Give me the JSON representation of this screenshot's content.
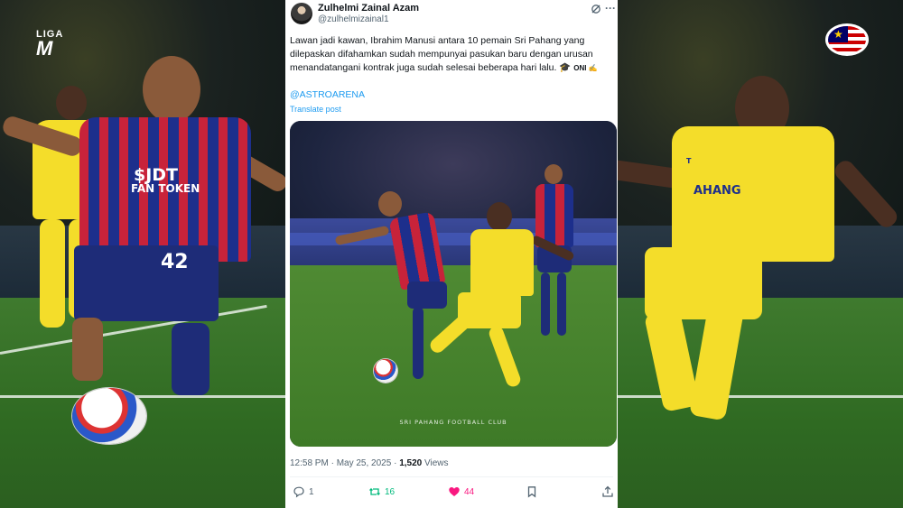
{
  "tweet": {
    "author_name": "Zulhelmi Zainal Azam",
    "author_handle": "@zulhelmizainal1",
    "text": "Lawan jadi kawan, Ibrahim Manusi antara 10 pemain Sri Pahang yang dilepaskan difahamkan sudah mempunyai pasukan baru dengan urusan menandatangani kontrak juga sudah selesai beberapa hari lalu. 🎓",
    "emoji_text": "ONI ✍",
    "mention": "@ASTROARENA",
    "translate_label": "Translate post",
    "media_caption": "SRI PAHANG FOOTBALL CLUB",
    "time": "12:58 PM",
    "date": "May 25, 2025",
    "views_count": "1,520",
    "views_label": "Views",
    "replies": "1",
    "reposts": "16",
    "likes": "44"
  },
  "background": {
    "left_logo_top": "LIGA",
    "left_logo_bottom": "M",
    "left_player_number": "42",
    "left_sponsor_1": "$JDT",
    "left_sponsor_2": "FAN TOKEN",
    "right_sponsor": "AHANG",
    "right_sponsor_prefix": "T"
  },
  "colors": {
    "like": "#f91880",
    "repost": "#00ba7c",
    "link": "#1d9bf0",
    "muted": "#536471"
  }
}
